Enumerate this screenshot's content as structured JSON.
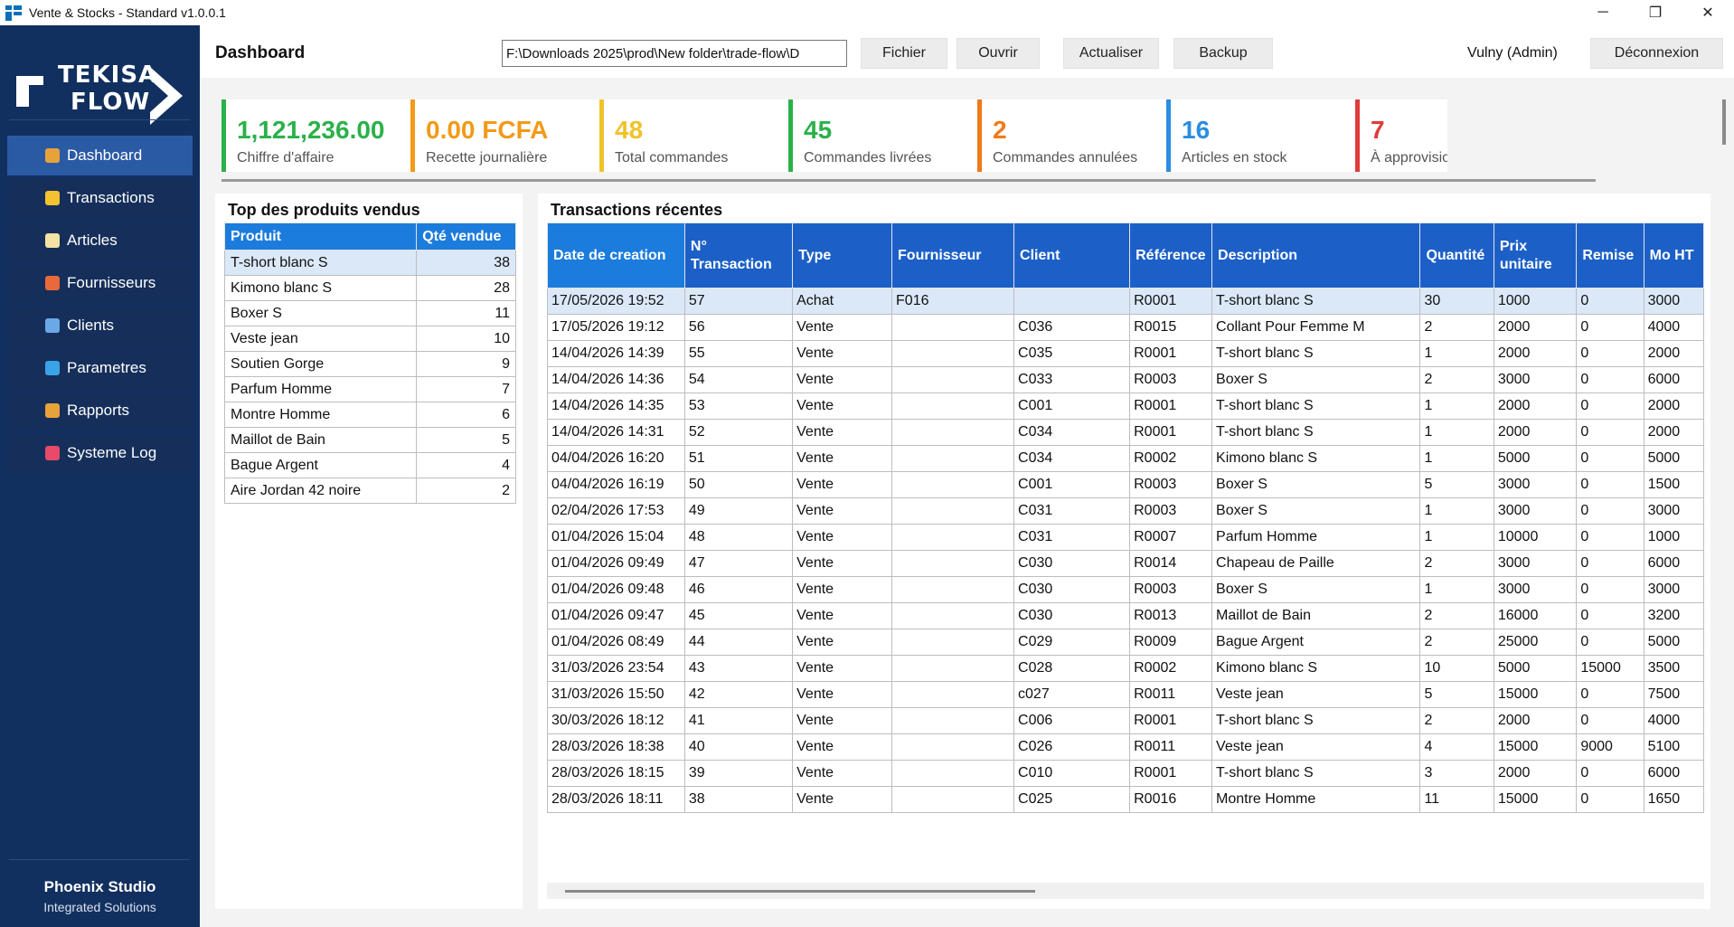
{
  "window": {
    "title": "Vente & Stocks - Standard v1.0.0.1",
    "controls": {
      "minimize": "─",
      "maximize": "❐",
      "close": "✕"
    }
  },
  "sidebar": {
    "logo_line1": "TEKISA",
    "logo_line2": "FLOW",
    "items": [
      {
        "label": "Dashboard",
        "icon": "dashboard-icon",
        "active": true,
        "color": "#e8a23a"
      },
      {
        "label": "Transactions",
        "icon": "transactions-icon",
        "active": false,
        "color": "#f2c230"
      },
      {
        "label": "Articles",
        "icon": "articles-icon",
        "active": false,
        "color": "#f4e3a4"
      },
      {
        "label": "Fournisseurs",
        "icon": "suppliers-icon",
        "active": false,
        "color": "#e86a3a"
      },
      {
        "label": "Clients",
        "icon": "clients-icon",
        "active": false,
        "color": "#6aa9e8"
      },
      {
        "label": "Parametres",
        "icon": "settings-icon",
        "active": false,
        "color": "#3aa3e8"
      },
      {
        "label": "Rapports",
        "icon": "reports-icon",
        "active": false,
        "color": "#e8a23a"
      },
      {
        "label": "Systeme Log",
        "icon": "system-log-icon",
        "active": false,
        "color": "#e84a6a"
      }
    ],
    "footer_name": "Phoenix Studio",
    "footer_sub": "Integrated Solutions"
  },
  "header": {
    "title": "Dashboard",
    "path_value": "F:\\Downloads 2025\\prod\\New folder\\trade-flow\\D",
    "buttons": {
      "file": "Fichier",
      "open": "Ouvrir",
      "refresh": "Actualiser",
      "backup": "Backup"
    },
    "user": "Vulny (Admin)",
    "logout": "Déconnexion"
  },
  "kpis": [
    {
      "value": "1,121,236.00",
      "label": "Chiffre d'affaire",
      "color": "#2bb14a"
    },
    {
      "value": "0.00 FCFA",
      "label": "Recette journalière",
      "color": "#f29a18"
    },
    {
      "value": "48",
      "label": "Total commandes",
      "color": "#f0c22b"
    },
    {
      "value": "45",
      "label": "Commandes livrées",
      "color": "#2bb14a"
    },
    {
      "value": "2",
      "label": "Commandes annulées",
      "color": "#f07a18"
    },
    {
      "value": "16",
      "label": "Articles en stock",
      "color": "#2a8de0"
    },
    {
      "value": "7",
      "label": "À approvisionner",
      "color": "#e03a3a"
    }
  ],
  "top_products": {
    "title": "Top des produits vendus",
    "headers": [
      "Produit",
      "Qté vendue"
    ],
    "rows": [
      [
        "T-short blanc S",
        "38"
      ],
      [
        "Kimono blanc S",
        "28"
      ],
      [
        "Boxer S",
        "11"
      ],
      [
        "Veste jean",
        "10"
      ],
      [
        "Soutien Gorge",
        "9"
      ],
      [
        "Parfum Homme",
        "7"
      ],
      [
        "Montre Homme",
        "6"
      ],
      [
        "Maillot de Bain",
        "5"
      ],
      [
        "Bague Argent",
        "4"
      ],
      [
        "Aire Jordan 42 noire",
        "2"
      ]
    ]
  },
  "transactions": {
    "title": "Transactions récentes",
    "headers": [
      "Date de creation",
      "N° Transaction",
      "Type",
      "Fournisseur",
      "Client",
      "Référence",
      "Description",
      "Quantité",
      "Prix unitaire",
      "Remise",
      "Mo HT"
    ],
    "rows": [
      [
        "17/05/2026 19:52",
        "57",
        "Achat",
        "F016",
        "",
        "R0001",
        "T-short blanc S",
        "30",
        "1000",
        "0",
        "3000"
      ],
      [
        "17/05/2026 19:12",
        "56",
        "Vente",
        "",
        "C036",
        "R0015",
        "Collant Pour Femme M",
        "2",
        "2000",
        "0",
        "4000"
      ],
      [
        "14/04/2026 14:39",
        "55",
        "Vente",
        "",
        "C035",
        "R0001",
        "T-short blanc S",
        "1",
        "2000",
        "0",
        "2000"
      ],
      [
        "14/04/2026 14:36",
        "54",
        "Vente",
        "",
        "C033",
        "R0003",
        "Boxer S",
        "2",
        "3000",
        "0",
        "6000"
      ],
      [
        "14/04/2026 14:35",
        "53",
        "Vente",
        "",
        "C001",
        "R0001",
        "T-short blanc S",
        "1",
        "2000",
        "0",
        "2000"
      ],
      [
        "14/04/2026 14:31",
        "52",
        "Vente",
        "",
        "C034",
        "R0001",
        "T-short blanc S",
        "1",
        "2000",
        "0",
        "2000"
      ],
      [
        "04/04/2026 16:20",
        "51",
        "Vente",
        "",
        "C034",
        "R0002",
        "Kimono blanc S",
        "1",
        "5000",
        "0",
        "5000"
      ],
      [
        "04/04/2026 16:19",
        "50",
        "Vente",
        "",
        "C001",
        "R0003",
        "Boxer S",
        "5",
        "3000",
        "0",
        "1500"
      ],
      [
        "02/04/2026 17:53",
        "49",
        "Vente",
        "",
        "C031",
        "R0003",
        "Boxer S",
        "1",
        "3000",
        "0",
        "3000"
      ],
      [
        "01/04/2026 15:04",
        "48",
        "Vente",
        "",
        "C031",
        "R0007",
        "Parfum Homme",
        "1",
        "10000",
        "0",
        "1000"
      ],
      [
        "01/04/2026 09:49",
        "47",
        "Vente",
        "",
        "C030",
        "R0014",
        "Chapeau de Paille",
        "2",
        "3000",
        "0",
        "6000"
      ],
      [
        "01/04/2026 09:48",
        "46",
        "Vente",
        "",
        "C030",
        "R0003",
        "Boxer S",
        "1",
        "3000",
        "0",
        "3000"
      ],
      [
        "01/04/2026 09:47",
        "45",
        "Vente",
        "",
        "C030",
        "R0013",
        "Maillot de Bain",
        "2",
        "16000",
        "0",
        "3200"
      ],
      [
        "01/04/2026 08:49",
        "44",
        "Vente",
        "",
        "C029",
        "R0009",
        "Bague Argent",
        "2",
        "25000",
        "0",
        "5000"
      ],
      [
        "31/03/2026 23:54",
        "43",
        "Vente",
        "",
        "C028",
        "R0002",
        "Kimono blanc S",
        "10",
        "5000",
        "15000",
        "3500"
      ],
      [
        "31/03/2026 15:50",
        "42",
        "Vente",
        "",
        "c027",
        "R0011",
        "Veste jean",
        "5",
        "15000",
        "0",
        "7500"
      ],
      [
        "30/03/2026 18:12",
        "41",
        "Vente",
        "",
        "C006",
        "R0001",
        "T-short blanc S",
        "2",
        "2000",
        "0",
        "4000"
      ],
      [
        "28/03/2026 18:38",
        "40",
        "Vente",
        "",
        "C026",
        "R0011",
        "Veste jean",
        "4",
        "15000",
        "9000",
        "5100"
      ],
      [
        "28/03/2026 18:15",
        "39",
        "Vente",
        "",
        "C010",
        "R0001",
        "T-short blanc S",
        "3",
        "2000",
        "0",
        "6000"
      ],
      [
        "28/03/2026 18:11",
        "38",
        "Vente",
        "",
        "C025",
        "R0016",
        "Montre Homme",
        "11",
        "15000",
        "0",
        "1650"
      ]
    ]
  }
}
